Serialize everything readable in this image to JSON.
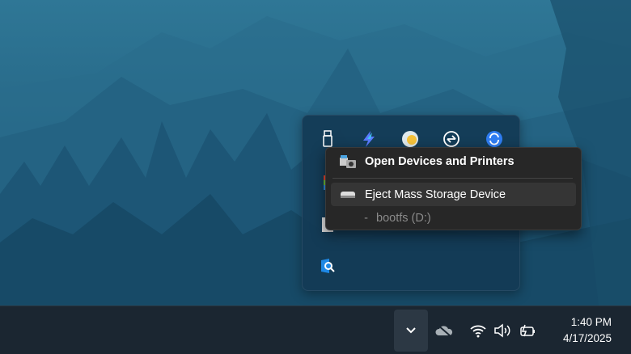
{
  "tray_overflow": {
    "icons": [
      "usb-icon",
      "lightning-app-icon",
      "night-light-icon",
      "sync-status-icon",
      "refresh-app-icon",
      "color-app-icon",
      "warning-app-icon",
      "search-app-icon"
    ]
  },
  "context_menu": {
    "open_devices": "Open Devices and Printers",
    "eject": "Eject Mass Storage Device",
    "volume_dash": "-",
    "volume": "bootfs (D:)"
  },
  "taskbar": {
    "time": "1:40 PM",
    "date": "4/17/2025"
  },
  "colors": {
    "accent": "#0a84d8",
    "menu_bg": "#272727",
    "taskbar_bg": "#1b2631"
  }
}
